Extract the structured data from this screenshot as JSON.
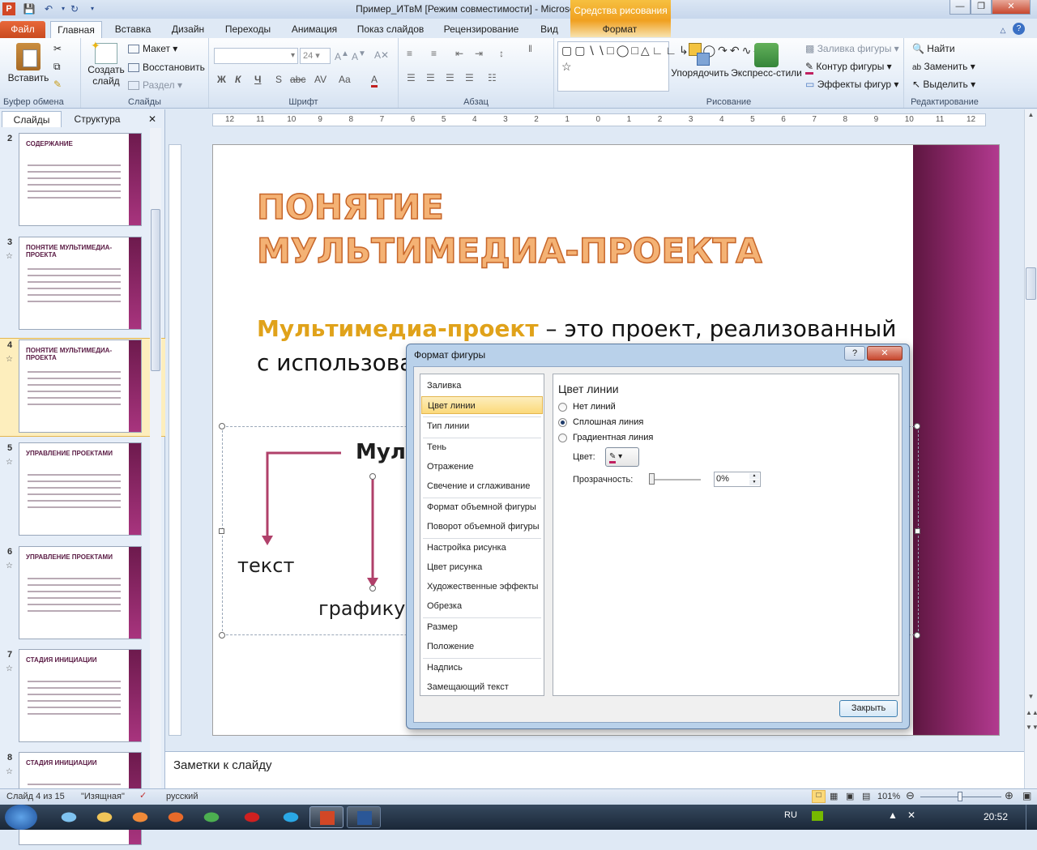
{
  "window": {
    "title": "Пример_ИТвМ [Режим совместимости] - Microsoft PowerPoint",
    "context_tab": "Средства рисования"
  },
  "tabs": {
    "file": "Файл",
    "home": "Главная",
    "insert": "Вставка",
    "design": "Дизайн",
    "transitions": "Переходы",
    "animation": "Анимация",
    "slideshow": "Показ слайдов",
    "review": "Рецензирование",
    "view": "Вид",
    "format": "Формат"
  },
  "ribbon": {
    "clipboard": {
      "label": "Буфер обмена",
      "paste": "Вставить"
    },
    "slides": {
      "label": "Слайды",
      "new_slide_1": "Создать",
      "new_slide_2": "слайд",
      "layout": "Макет",
      "reset": "Восстановить",
      "section": "Раздел"
    },
    "font": {
      "label": "Шрифт",
      "size": "24",
      "b": "Ж",
      "i": "К",
      "u": "Ч",
      "s": "S",
      "abc": "abc",
      "av": "AV",
      "aa": "Aa"
    },
    "paragraph": {
      "label": "Абзац"
    },
    "drawing": {
      "label": "Рисование",
      "arrange": "Упорядочить",
      "quick_styles": "Экспресс-стили",
      "fill": "Заливка фигуры",
      "outline": "Контур фигуры",
      "effects": "Эффекты фигур"
    },
    "editing": {
      "label": "Редактирование",
      "find": "Найти",
      "replace": "Заменить",
      "select": "Выделить"
    }
  },
  "panel": {
    "tab_slides": "Слайды",
    "tab_outline": "Структура",
    "close": "✕",
    "thumbs": [
      {
        "num": "2",
        "star": "",
        "title": "СОДЕРЖАНИЕ"
      },
      {
        "num": "3",
        "star": "☆",
        "title": "ПОНЯТИЕ МУЛЬТИМЕДИА-ПРОЕКТА"
      },
      {
        "num": "4",
        "star": "☆",
        "title": "ПОНЯТИЕ МУЛЬТИМЕДИА-ПРОЕКТА"
      },
      {
        "num": "5",
        "star": "☆",
        "title": "УПРАВЛЕНИЕ ПРОЕКТАМИ"
      },
      {
        "num": "6",
        "star": "☆",
        "title": "УПРАВЛЕНИЕ ПРОЕКТАМИ"
      },
      {
        "num": "7",
        "star": "☆",
        "title": "СТАДИЯ ИНИЦИАЦИИ"
      },
      {
        "num": "8",
        "star": "☆",
        "title": "СТАДИЯ ИНИЦИАЦИИ"
      }
    ]
  },
  "ruler": {
    "h_ticks": [
      "12",
      "11",
      "10",
      "9",
      "8",
      "7",
      "6",
      "5",
      "4",
      "3",
      "2",
      "1",
      "0",
      "1",
      "2",
      "3",
      "4",
      "5",
      "6",
      "7",
      "8",
      "9",
      "10",
      "11",
      "12"
    ]
  },
  "slide": {
    "title": "ПОНЯТИЕ МУЛЬТИМЕДИА-ПРОЕКТА",
    "body_term": "Мультимедиа-проект",
    "body_rest_1": " –  это проект, реализованный",
    "body_rest_2": "с использованием мультимедиа-технологий",
    "diagram_top": "Мультимедиа",
    "diagram_text": "текст",
    "diagram_graphics": "графику"
  },
  "notes": {
    "placeholder": "Заметки к слайду"
  },
  "status": {
    "slide": "Слайд 4 из 15",
    "theme": "\"Изящная\"",
    "lang": "русский",
    "zoom": "101%"
  },
  "taskbar": {
    "lang": "RU",
    "time": "20:52"
  },
  "dialog": {
    "title": "Формат фигуры",
    "help": "?",
    "close": "✕",
    "categories": [
      "Заливка",
      "Цвет линии",
      "Тип линии",
      "Тень",
      "Отражение",
      "Свечение и сглаживание",
      "Формат объемной фигуры",
      "Поворот объемной фигуры",
      "Настройка рисунка",
      "Цвет рисунка",
      "Художественные эффекты",
      "Обрезка",
      "Размер",
      "Положение",
      "Надпись",
      "Замещающий текст"
    ],
    "selected_category": "Цвет линии",
    "pane_title": "Цвет линии",
    "options": {
      "none": "Нет линий",
      "solid": "Сплошная линия",
      "gradient": "Градиентная линия"
    },
    "color_label": "Цвет:",
    "transparency_label": "Прозрачность:",
    "transparency_value": "0%",
    "close_button": "Закрыть"
  }
}
